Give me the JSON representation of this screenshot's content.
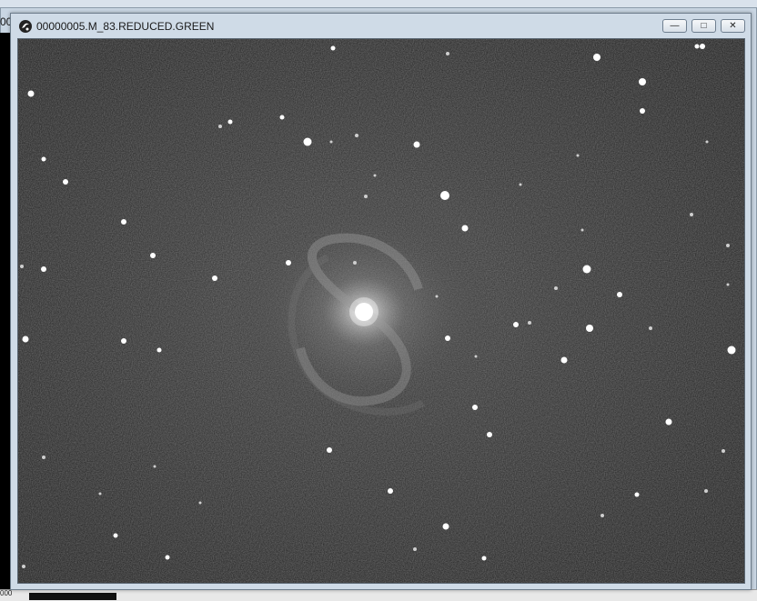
{
  "background_window": {
    "title_fragment": "00",
    "bottom_label": "000"
  },
  "window": {
    "title": "00000005.M_83.REDUCED.GREEN",
    "icon": "app-logo-icon",
    "controls": {
      "minimize_icon": "minimize-icon",
      "maximize_icon": "maximize-icon",
      "close_icon": "close-icon",
      "minimize_glyph": "—",
      "maximize_glyph": "□",
      "close_glyph": "✕"
    }
  },
  "image": {
    "description_type": "astronomical-image",
    "colors": {
      "sky": "#222222",
      "star": "#ffffff",
      "galaxy_core": "#ffffff"
    }
  }
}
